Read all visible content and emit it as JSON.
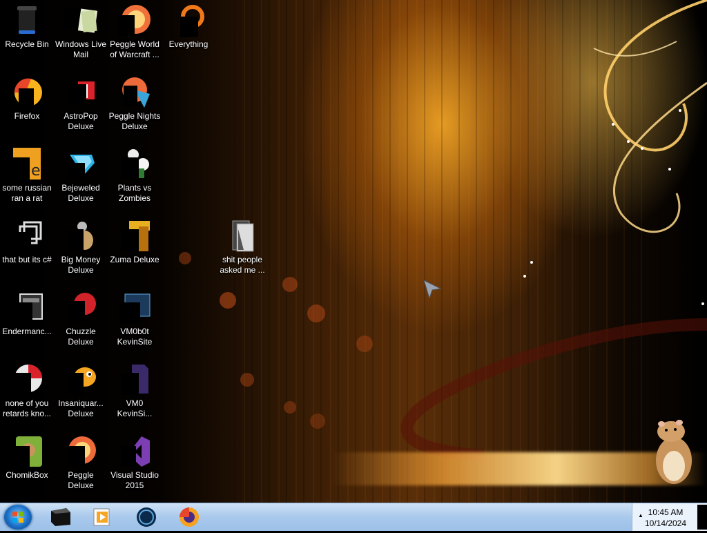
{
  "desktop": {
    "icons": [
      {
        "label": "Recycle Bin",
        "icon": "recycle-bin-icon"
      },
      {
        "label": "Windows Live Mail",
        "icon": "mail-icon"
      },
      {
        "label": "Peggle World of Warcraft ...",
        "icon": "peggle-icon"
      },
      {
        "label": "Everything",
        "icon": "search-icon"
      },
      {
        "label": "Firefox",
        "icon": "firefox-icon"
      },
      {
        "label": "AstroPop Deluxe",
        "icon": "astropop-icon"
      },
      {
        "label": "Peggle Nights Deluxe",
        "icon": "peggle-icon"
      },
      {
        "label": "some russian ran a rat",
        "icon": "app-icon"
      },
      {
        "label": "Bejeweled Deluxe",
        "icon": "gem-icon"
      },
      {
        "label": "Plants vs Zombies",
        "icon": "plant-icon"
      },
      {
        "label": "that but its c#",
        "icon": "windows-icon"
      },
      {
        "label": "Big Money Deluxe",
        "icon": "money-icon"
      },
      {
        "label": "Zuma Deluxe",
        "icon": "zuma-icon"
      },
      {
        "label": "shit people asked me ...",
        "icon": "folder-icon"
      },
      {
        "label": "Endermanc...",
        "icon": "app-icon"
      },
      {
        "label": "Chuzzle Deluxe",
        "icon": "chuzzle-icon"
      },
      {
        "label": "VM0b0t KevinSite",
        "icon": "app-icon"
      },
      {
        "label": "none of you retards kno...",
        "icon": "app-icon"
      },
      {
        "label": "Insaniquar... Deluxe",
        "icon": "fish-icon"
      },
      {
        "label": "VM0 KevinSi...",
        "icon": "file-icon"
      },
      {
        "label": "ChomikBox",
        "icon": "chomikbox-icon"
      },
      {
        "label": "Peggle Deluxe",
        "icon": "peggle-icon"
      },
      {
        "label": "Visual Studio 2015",
        "icon": "visual-studio-icon"
      }
    ]
  },
  "taskbar": {
    "pinned": [
      {
        "name": "command-prompt",
        "icon": "terminal-icon"
      },
      {
        "name": "media-player",
        "icon": "media-player-icon"
      },
      {
        "name": "globe",
        "icon": "globe-icon"
      },
      {
        "name": "firefox",
        "icon": "firefox-icon"
      }
    ],
    "tray_arrow": "▲",
    "clock": {
      "time": "10:45 AM",
      "date": "10/14/2024"
    }
  },
  "colors": {
    "taskbar": "#a9c9ec",
    "accent_orange": "#f5a623"
  }
}
